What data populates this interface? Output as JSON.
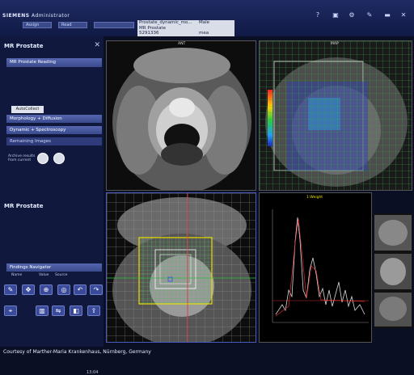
{
  "topbar": {
    "brand": "SIEMENS",
    "user": "Administrator",
    "workflow_steps": [
      "Assign",
      "Read"
    ],
    "patient": {
      "name": "Prostate_dynamic_mo...",
      "sex": "Male",
      "protocol": "MR Prostate",
      "id": "5291336",
      "unit": "mea"
    },
    "icons": [
      "help-icon",
      "archive-icon",
      "settings-icon",
      "tools-icon",
      "minimize-icon",
      "close-icon"
    ]
  },
  "leftpanel": {
    "title": "MR Prostate",
    "reading_section": "MR Prostate Reading",
    "autocollect_label": "AutoCollect",
    "sections": [
      "Morphology + Diffusion",
      "Dynamic + Spectroscopy"
    ],
    "remaining": "Remaining Images",
    "archive_text": "Archive results from current",
    "findings_navigator": "Findings Navigator",
    "findings_columns": [
      "Name",
      "Value",
      "Source"
    ],
    "time": "13:04"
  },
  "viewers": {
    "axial_label": "ANT",
    "map_label": "MAP",
    "spectrum_label": "1:Weight"
  },
  "credit": "Courtesy of Marther-Maria Krankenhaus, Nürnberg, Germany"
}
